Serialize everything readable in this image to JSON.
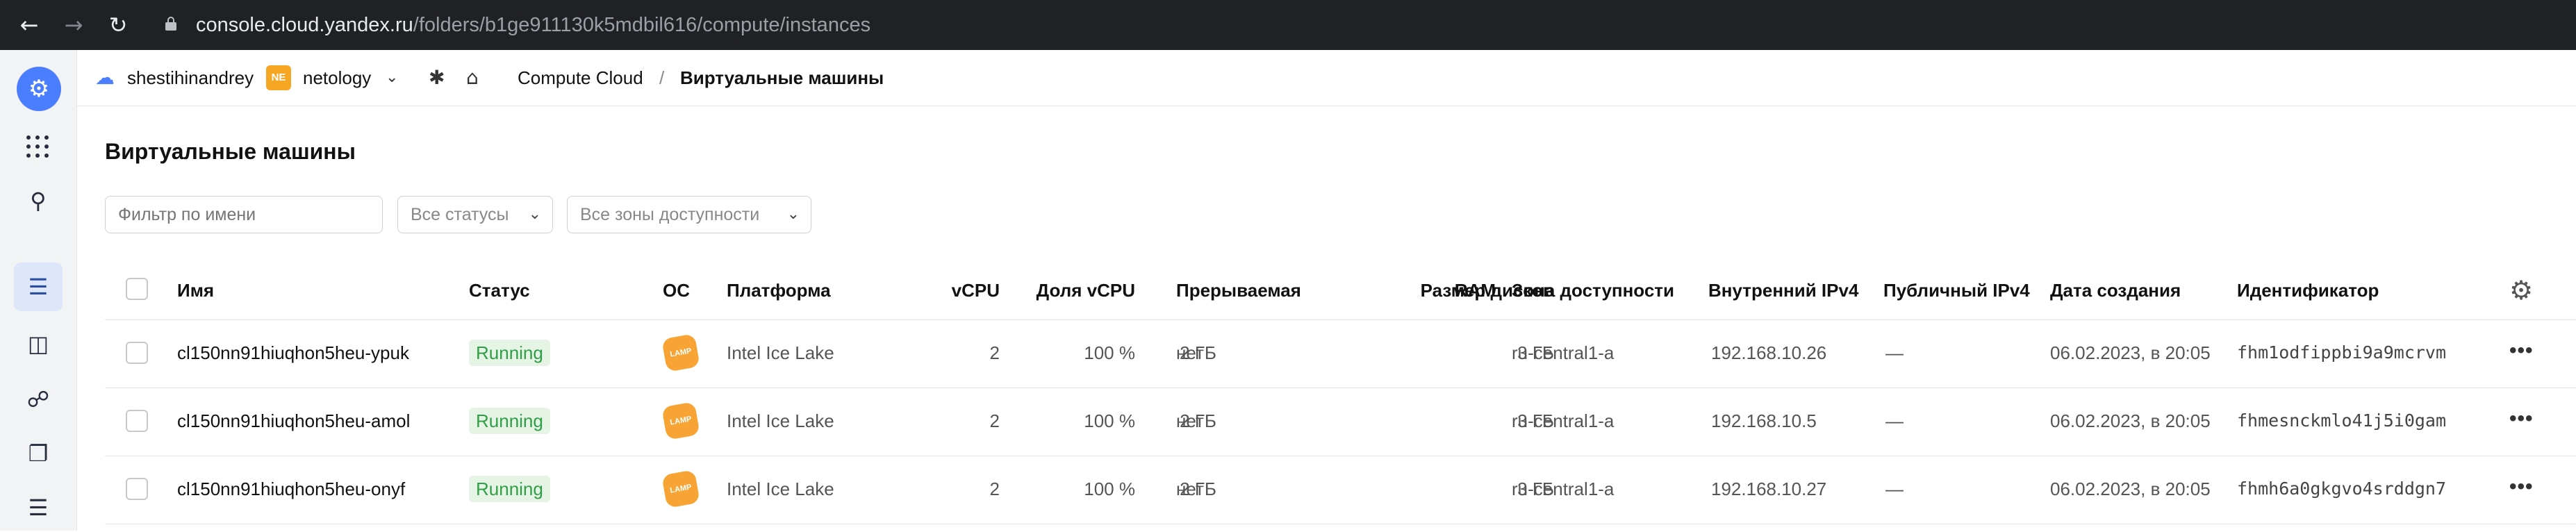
{
  "browser": {
    "url_host": "console.cloud.yandex.ru",
    "url_path": "/folders/b1ge911130k5mdbil616/compute/instances"
  },
  "topbar": {
    "account": "shestihinandrey",
    "folder_badge": "NE",
    "folder": "netology",
    "service": "Compute Cloud",
    "separator": "/",
    "current": "Виртуальные машины"
  },
  "page": {
    "title": "Виртуальные машины",
    "filter_placeholder": "Фильтр по имени",
    "status_select": "Все статусы",
    "zone_select": "Все зоны доступности"
  },
  "table": {
    "columns": {
      "name": "Имя",
      "status": "Статус",
      "os": "ОС",
      "platform": "Платформа",
      "vcpu": "vCPU",
      "vcpu_share": "Доля vCPU",
      "ram": "RAM",
      "preemptible": "Прерываемая",
      "disk_size": "Размер дисков",
      "zone": "Зона доступности",
      "internal_ip": "Внутренний IPv4",
      "public_ip": "Публичный IPv4",
      "created": "Дата создания",
      "id": "Идентификатор"
    },
    "rows": [
      {
        "name": "cl150nn91hiuqhon5heu-ypuk",
        "status": "Running",
        "os": "LAMP",
        "platform": "Intel Ice Lake",
        "vcpu": "2",
        "vcpu_share": "100 %",
        "ram": "2 ГБ",
        "preemptible": "нет",
        "disk_size": "3 ГБ",
        "zone": "ru-central1-a",
        "internal_ip": "192.168.10.26",
        "public_ip": "—",
        "created": "06.02.2023, в 20:05",
        "id": "fhm1odfippbi9a9mcrvm"
      },
      {
        "name": "cl150nn91hiuqhon5heu-amol",
        "status": "Running",
        "os": "LAMP",
        "platform": "Intel Ice Lake",
        "vcpu": "2",
        "vcpu_share": "100 %",
        "ram": "2 ГБ",
        "preemptible": "нет",
        "disk_size": "3 ГБ",
        "zone": "ru-central1-a",
        "internal_ip": "192.168.10.5",
        "public_ip": "—",
        "created": "06.02.2023, в 20:05",
        "id": "fhmesnckmlo41j5i0gam"
      },
      {
        "name": "cl150nn91hiuqhon5heu-onyf",
        "status": "Running",
        "os": "LAMP",
        "platform": "Intel Ice Lake",
        "vcpu": "2",
        "vcpu_share": "100 %",
        "ram": "2 ГБ",
        "preemptible": "нет",
        "disk_size": "3 ГБ",
        "zone": "ru-central1-a",
        "internal_ip": "192.168.10.27",
        "public_ip": "—",
        "created": "06.02.2023, в 20:05",
        "id": "fhmh6a0gkgvo4srddgn7"
      }
    ],
    "row_actions": "•••"
  },
  "colors": {
    "accent": "#4b7dff",
    "running_text": "#2f9e44",
    "running_bg": "#e6f4e6",
    "lamp_badge": "#f7a434",
    "folder_badge": "#f5a623"
  }
}
